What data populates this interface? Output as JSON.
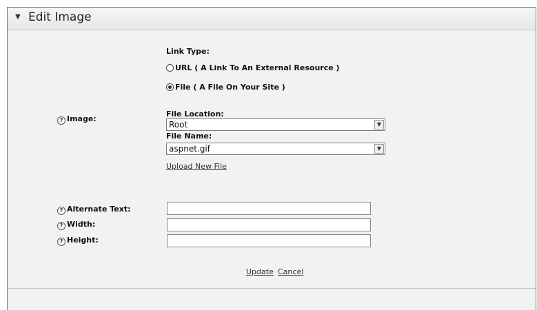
{
  "header": {
    "collapse_icon": "▼",
    "title": "Edit Image"
  },
  "link_type": {
    "label": "Link Type:",
    "options": [
      {
        "label": "URL ( A Link To An External Resource )",
        "selected": false
      },
      {
        "label": "File ( A File On Your Site )",
        "selected": true
      }
    ]
  },
  "image": {
    "label": "Image:",
    "file_location_label": "File Location:",
    "file_location_value": "Root",
    "file_name_label": "File Name:",
    "file_name_value": "aspnet.gif",
    "upload_link": "Upload New File"
  },
  "fields": {
    "alternate_text_label": "Alternate Text:",
    "width_label": "Width:",
    "height_label": "Height:",
    "alternate_text_value": "",
    "width_value": "",
    "height_value": ""
  },
  "actions": {
    "update": "Update",
    "cancel": "Cancel"
  },
  "icons": {
    "help": "help-icon",
    "dropdown": "chevron-down-icon",
    "collapse": "collapse-triangle-icon"
  }
}
